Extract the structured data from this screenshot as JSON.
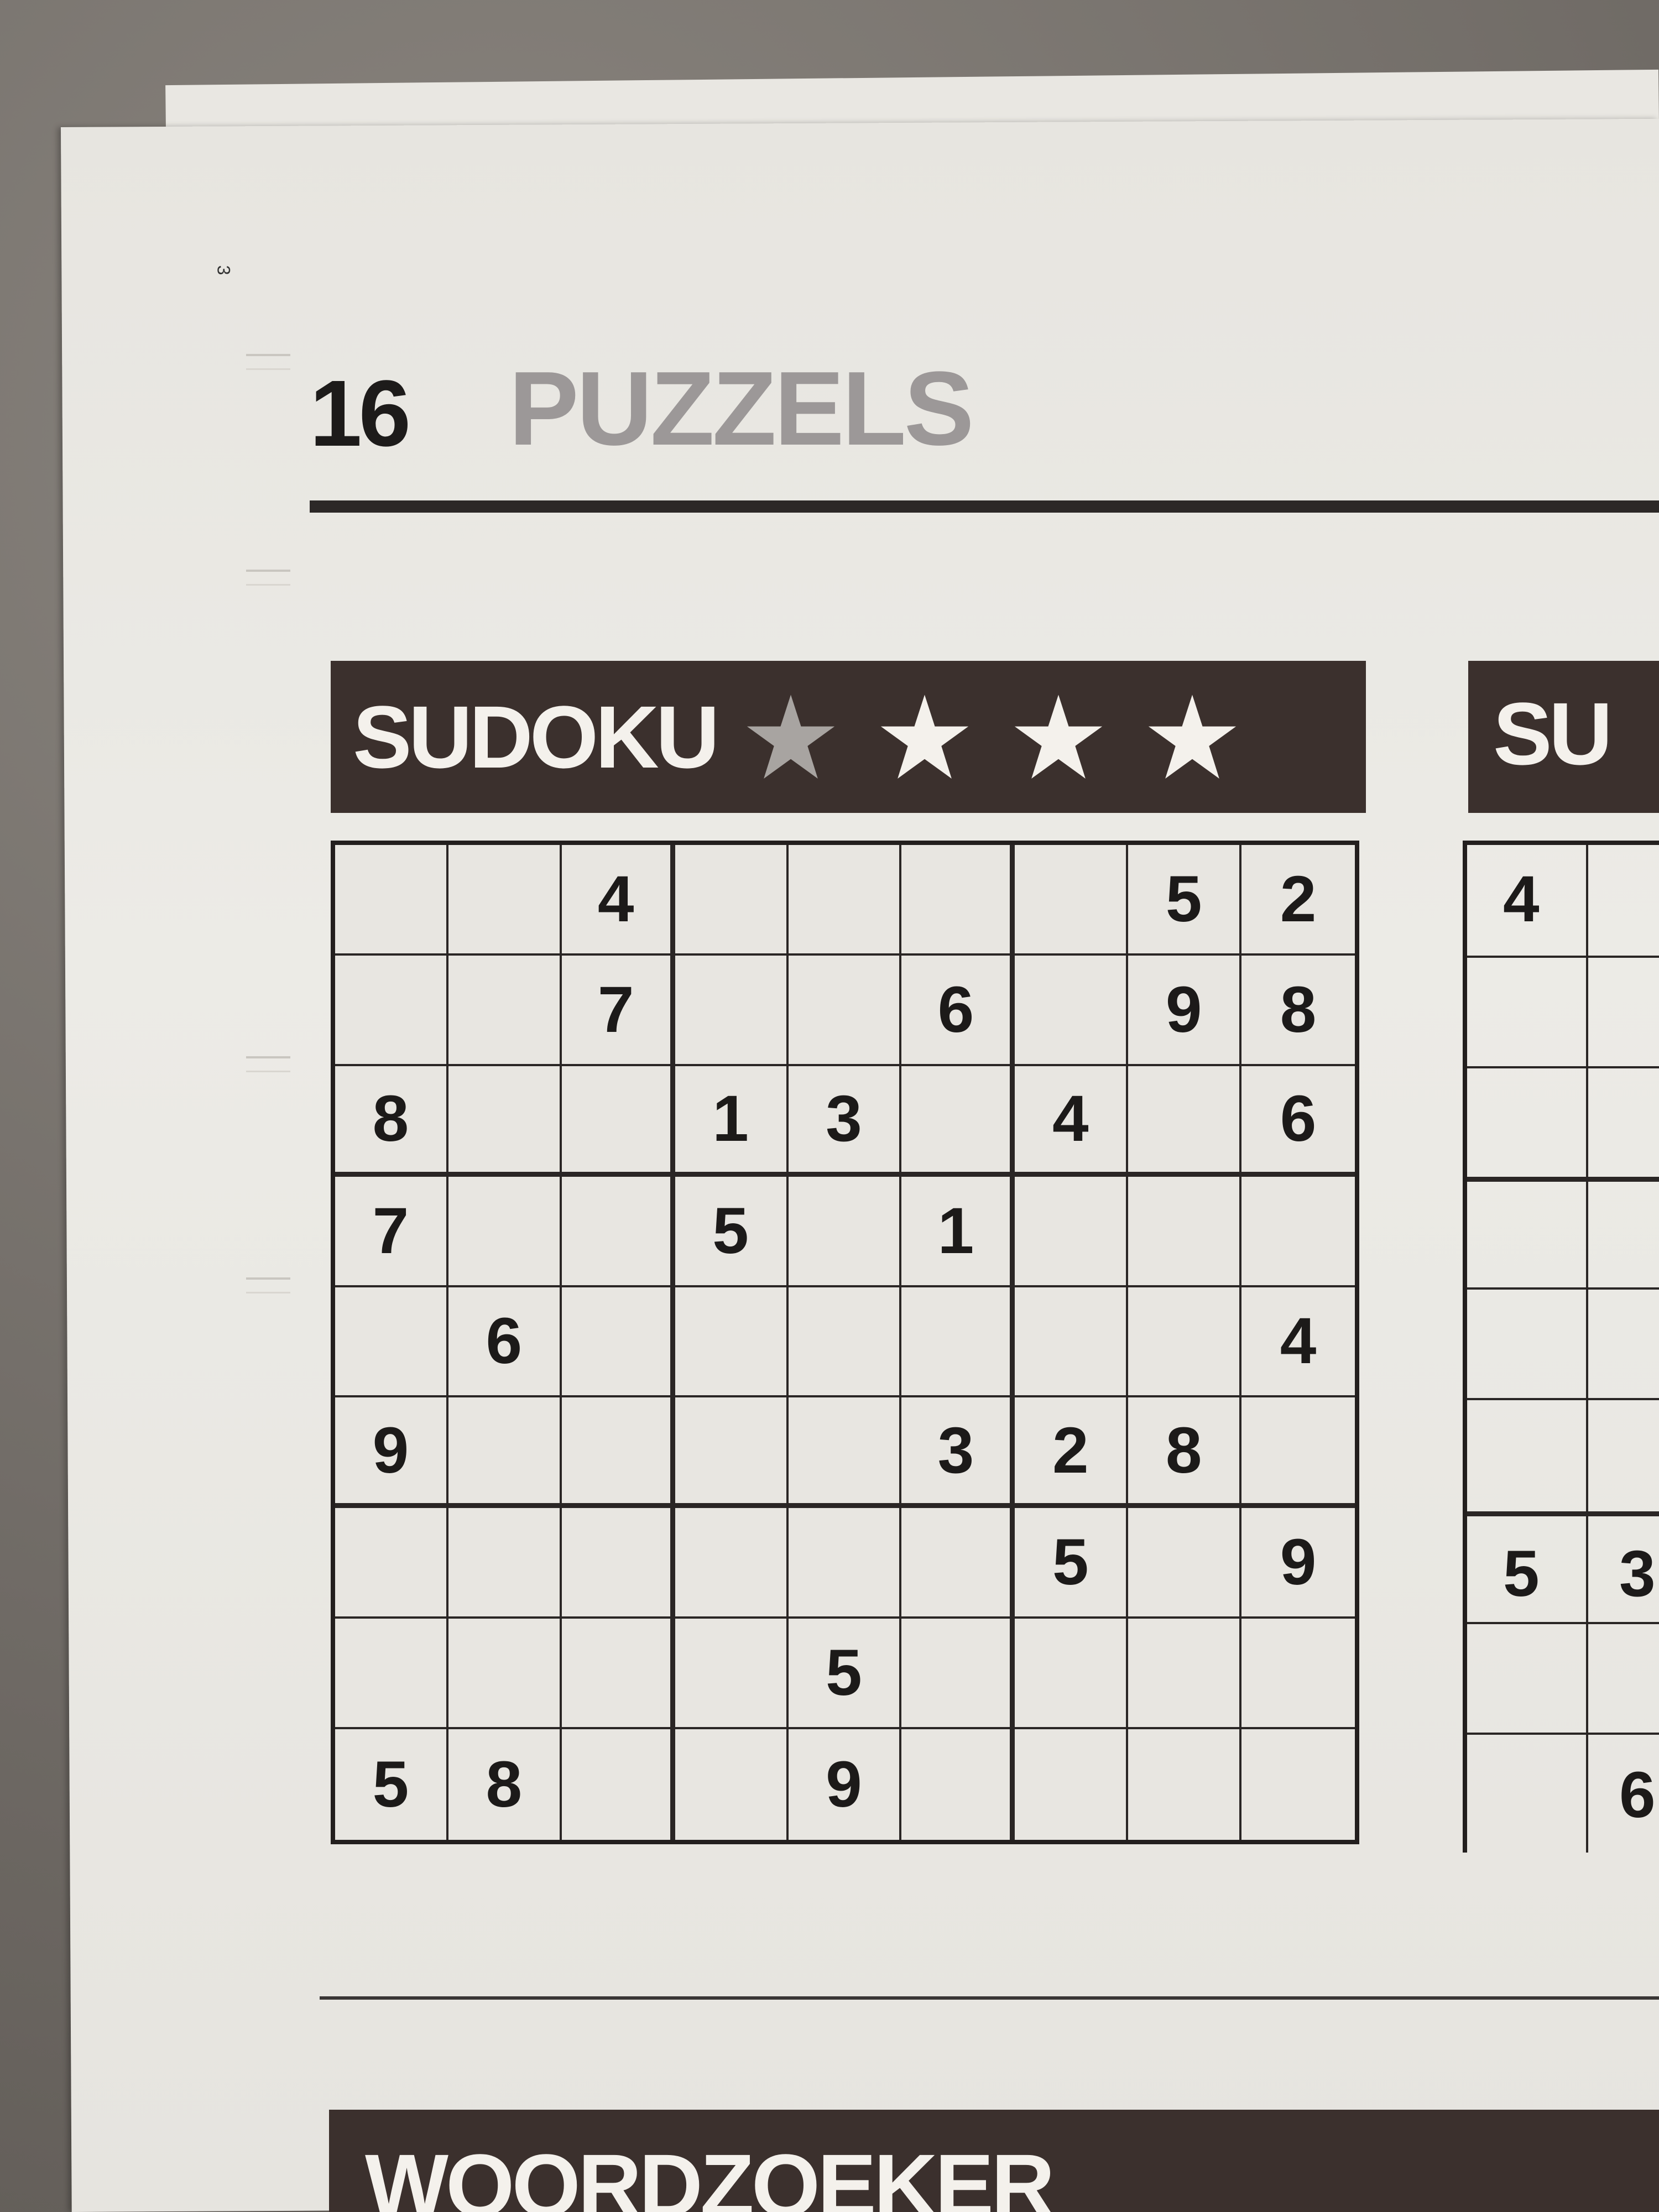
{
  "page": {
    "corner_mark": "3",
    "number": "16",
    "section": "PUZZELS"
  },
  "sudoku": {
    "title": "SUDOKU",
    "difficulty_stars": 4,
    "star_colors": [
      "#a8a4a1",
      "#f4f1ec",
      "#f4f1ec",
      "#f4f1ec"
    ],
    "grid": [
      [
        "",
        "",
        "4",
        "",
        "",
        "",
        "",
        "5",
        "2"
      ],
      [
        "",
        "",
        "7",
        "",
        "",
        "6",
        "",
        "9",
        "8"
      ],
      [
        "8",
        "",
        "",
        "1",
        "3",
        "",
        "4",
        "",
        "6"
      ],
      [
        "7",
        "",
        "",
        "5",
        "",
        "1",
        "",
        "",
        ""
      ],
      [
        "",
        "6",
        "",
        "",
        "",
        "",
        "",
        "",
        "4"
      ],
      [
        "9",
        "",
        "",
        "",
        "",
        "3",
        "2",
        "8",
        ""
      ],
      [
        "",
        "",
        "",
        "",
        "",
        "",
        "5",
        "",
        "9"
      ],
      [
        "",
        "",
        "",
        "",
        "5",
        "",
        "",
        "",
        ""
      ],
      [
        "5",
        "8",
        "",
        "",
        "9",
        "",
        "",
        "",
        ""
      ]
    ]
  },
  "second_sudoku": {
    "title_fragment": "SU",
    "visible_digits": [
      {
        "row": 0,
        "value": "4"
      },
      {
        "row": 6,
        "value": "5"
      },
      {
        "row": 6,
        "value": "3"
      },
      {
        "row": 8,
        "value": "6"
      }
    ]
  },
  "next_section": {
    "title": "WOORDZOEKER"
  },
  "colors": {
    "banner": "#3b302d",
    "ink": "#1c1a19",
    "section_title": "#9c9898",
    "paper": "#e8e6e1"
  }
}
